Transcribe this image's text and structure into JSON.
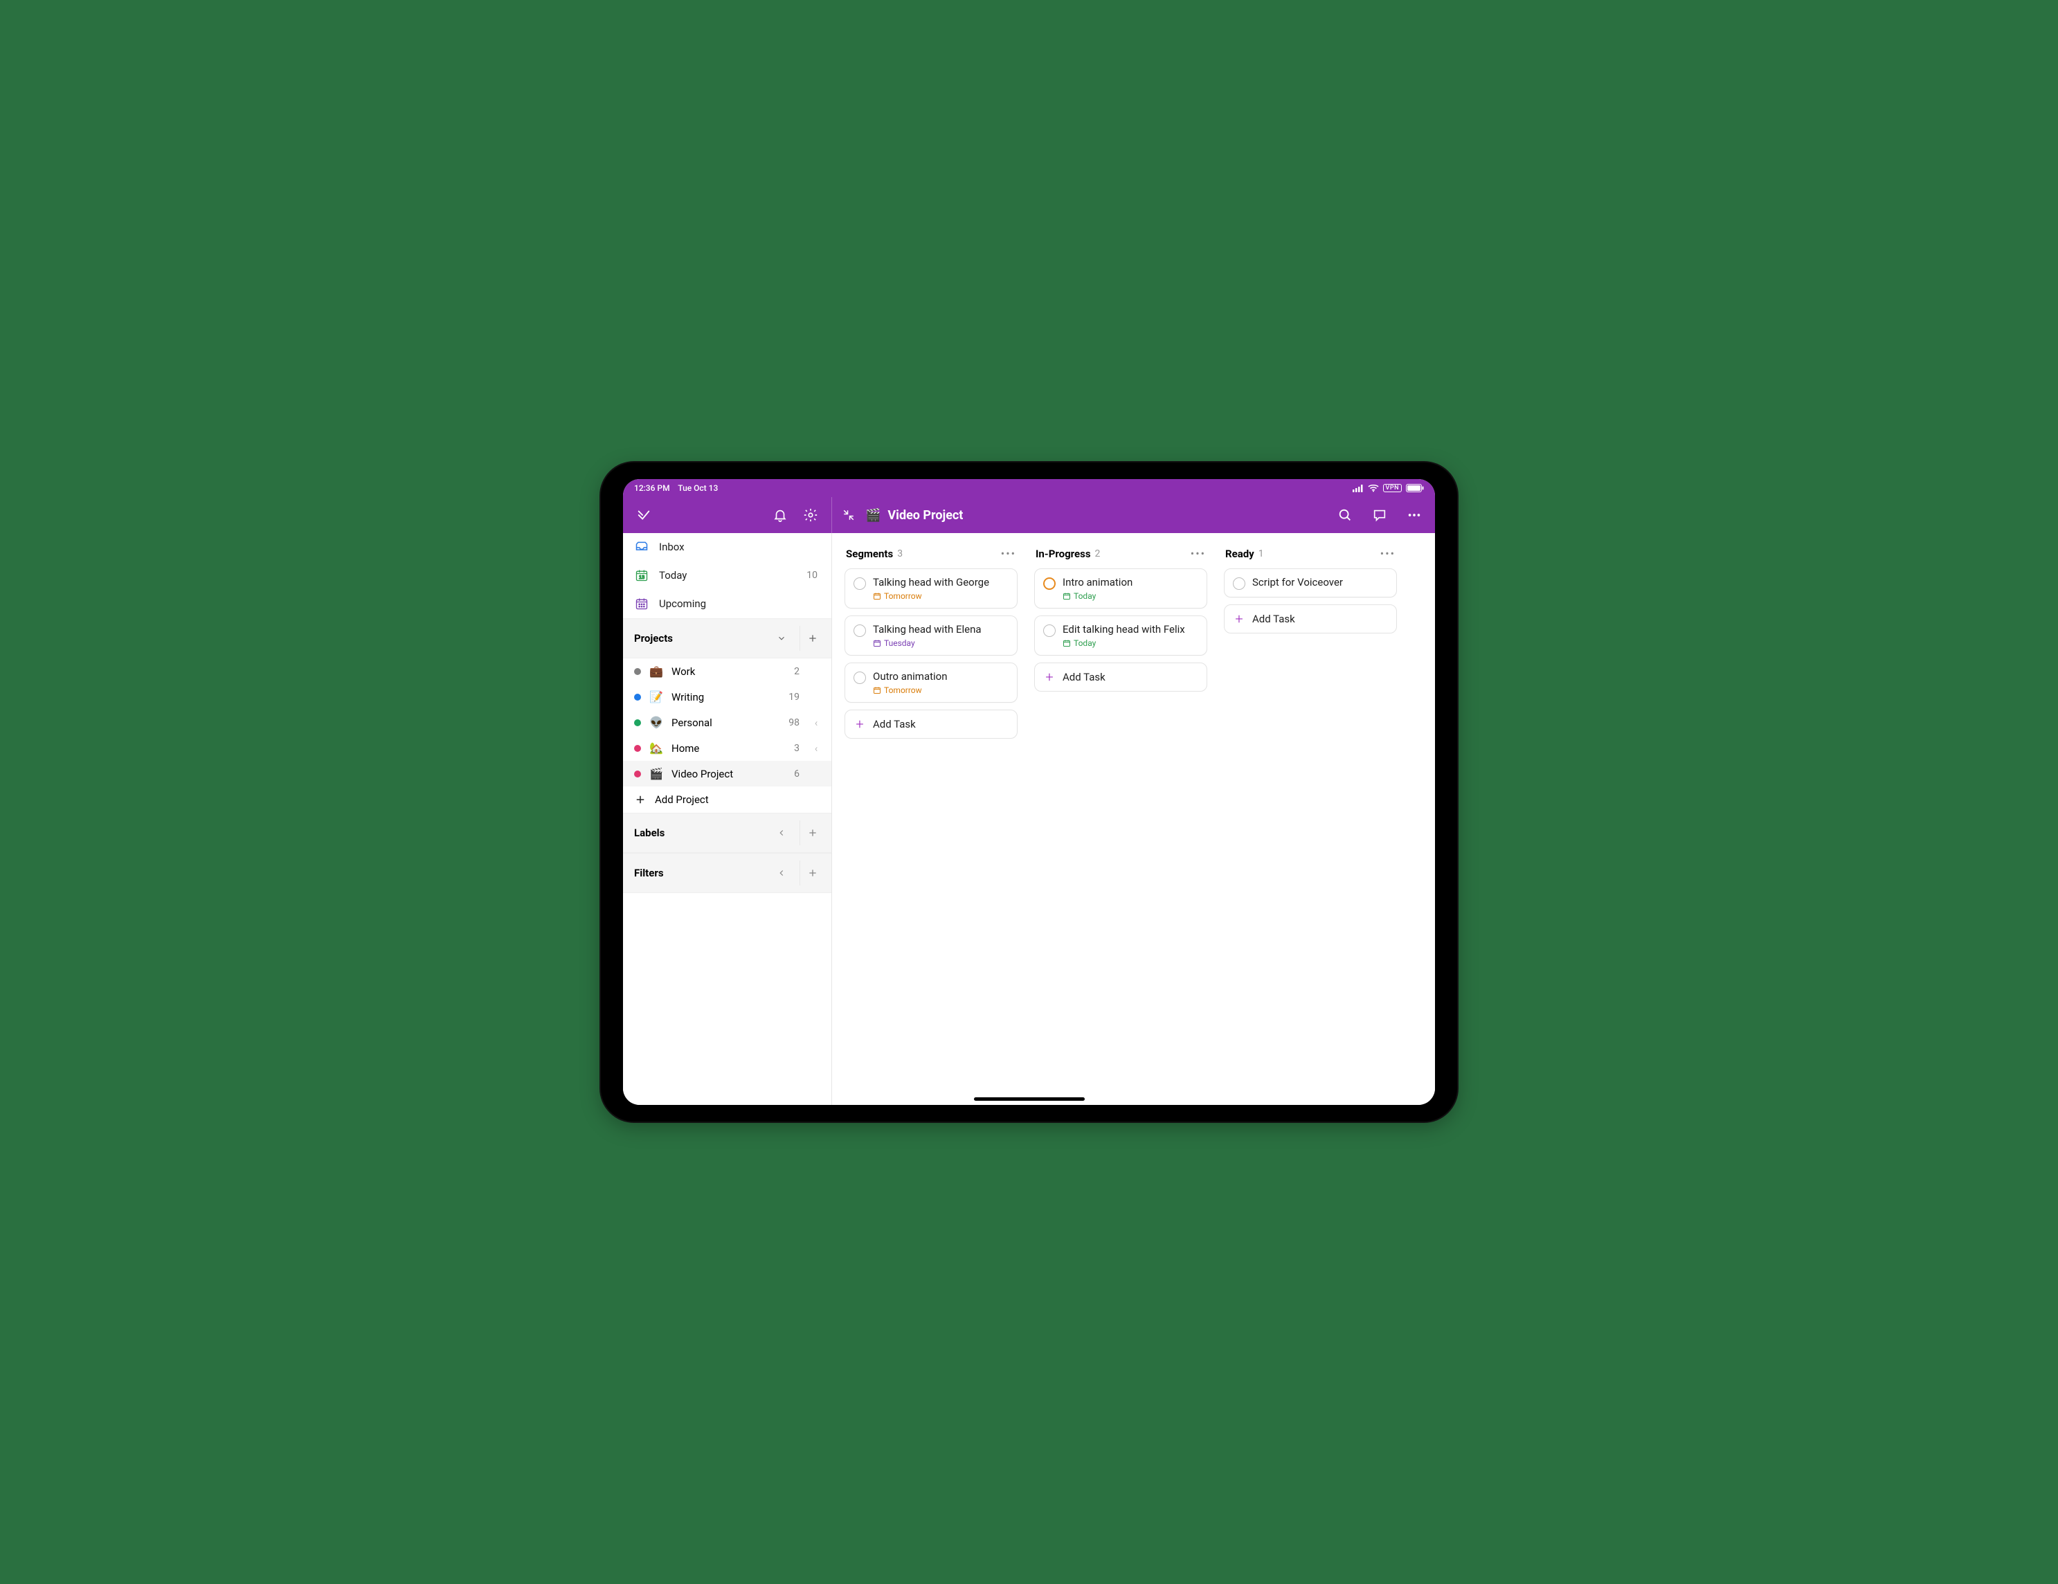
{
  "statusbar": {
    "time": "12:36 PM",
    "date": "Tue Oct 13",
    "vpn": "VPN"
  },
  "header": {
    "project_emoji": "🎬",
    "project_title": "Video Project"
  },
  "sidebar": {
    "inbox": "Inbox",
    "today": "Today",
    "today_count": "10",
    "today_date_num": "13",
    "upcoming": "Upcoming",
    "projects_label": "Projects",
    "projects": [
      {
        "dot": "#808080",
        "emoji": "💼",
        "name": "Work",
        "count": "2",
        "chev": ""
      },
      {
        "dot": "#1e7ae8",
        "emoji": "📝",
        "name": "Writing",
        "count": "19",
        "chev": ""
      },
      {
        "dot": "#1ea561",
        "emoji": "👽",
        "name": "Personal",
        "count": "98",
        "chev": "‹"
      },
      {
        "dot": "#e0366e",
        "emoji": "🏡",
        "name": "Home",
        "count": "3",
        "chev": "‹"
      },
      {
        "dot": "#e0366e",
        "emoji": "🎬",
        "name": "Video Project",
        "count": "6",
        "chev": "",
        "selected": true
      }
    ],
    "add_project": "Add Project",
    "labels_label": "Labels",
    "filters_label": "Filters"
  },
  "board": {
    "add_task_label": "Add Task",
    "columns": [
      {
        "name": "Segments",
        "count": "3",
        "tasks": [
          {
            "title": "Talking head with George",
            "due": "Tomorrow",
            "due_class": "orange",
            "circle": ""
          },
          {
            "title": "Talking head with Elena",
            "due": "Tuesday",
            "due_class": "purple",
            "circle": ""
          },
          {
            "title": "Outro animation",
            "due": "Tomorrow",
            "due_class": "orange",
            "circle": ""
          }
        ]
      },
      {
        "name": "In-Progress",
        "count": "2",
        "tasks": [
          {
            "title": "Intro animation",
            "due": "Today",
            "due_class": "green",
            "circle": "orange"
          },
          {
            "title": "Edit talking head with Felix",
            "due": "Today",
            "due_class": "green",
            "circle": ""
          }
        ]
      },
      {
        "name": "Ready",
        "count": "1",
        "tasks": [
          {
            "title": "Script for Voiceover",
            "due": "",
            "due_class": "",
            "circle": ""
          }
        ]
      }
    ]
  }
}
